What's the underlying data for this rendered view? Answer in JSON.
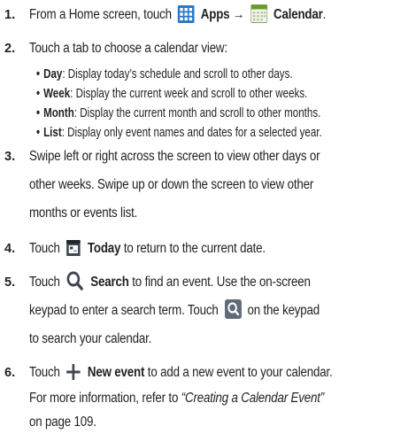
{
  "step1": {
    "num": "1.",
    "pre": "From a Home screen, touch",
    "apps": "Apps",
    "arrow": "→",
    "calendar": "Calendar",
    "end": "."
  },
  "step2": {
    "num": "2.",
    "text": "Touch a tab to choose a calendar view:",
    "bullets": [
      {
        "label": "Day",
        "text": ": Display today’s schedule and scroll to other days."
      },
      {
        "label": "Week",
        "text": ": Display the current week and scroll to other weeks."
      },
      {
        "label": "Month",
        "text": ": Display the current month and scroll to other months."
      },
      {
        "label": "List",
        "text": ": Display only event names and dates for a selected year."
      }
    ]
  },
  "step3": {
    "num": "3.",
    "lines": [
      "Swipe left or right across the screen to view other days or",
      "other weeks. Swipe up or down the screen to view other",
      "months or events list."
    ]
  },
  "step4": {
    "num": "4.",
    "pre": "Touch",
    "today": "Today",
    "post": "to return to the current date."
  },
  "step5": {
    "num": "5.",
    "pre": "Touch",
    "search": "Search",
    "post": "to find an event. Use the on-screen",
    "line2": "keypad to enter a search term. Touch",
    "line2b": "on the keypad",
    "line3": "to search your calendar."
  },
  "step6": {
    "num": "6.",
    "pre": "Touch",
    "newevent": "New event",
    "post": "to add a new event to your calendar.",
    "line2": "For more information, refer to",
    "ref": "“Creating a Calendar Event”",
    "line3": "on page 109."
  },
  "colors": {
    "apps_icon": "#2a78c8",
    "calendar_icon": "#6a9a2e",
    "search_key": "#5f6b75"
  },
  "icons": [
    "apps-grid-icon",
    "calendar-icon",
    "today-icon",
    "search-icon",
    "search-key-icon",
    "plus-icon"
  ]
}
